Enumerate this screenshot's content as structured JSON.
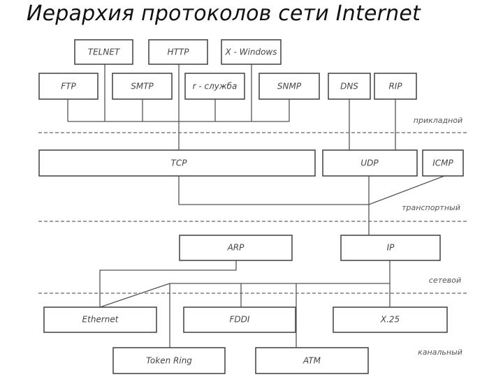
{
  "title": "Иерархия протоколов сети Internet",
  "layers": {
    "application": "прикладной",
    "transport": "транспортный",
    "network": "сетевой",
    "link": "канальный"
  },
  "protocols": {
    "telnet": "TELNET",
    "http": "HTTP",
    "xwindows": "X - Windows",
    "ftp": "FTP",
    "smtp": "SMTP",
    "rservice": "r - служба",
    "snmp": "SNMP",
    "dns": "DNS",
    "rip": "RIP",
    "tcp": "TCP",
    "udp": "UDP",
    "icmp": "ICMP",
    "arp": "ARP",
    "ip": "IP",
    "ethernet": "Ethernet",
    "fddi": "FDDI",
    "x25": "X.25",
    "tokenring": "Token Ring",
    "atm": "ATM"
  },
  "colors": {
    "line": "#555555",
    "box_border": "#4a4a4a",
    "text": "#444444"
  }
}
